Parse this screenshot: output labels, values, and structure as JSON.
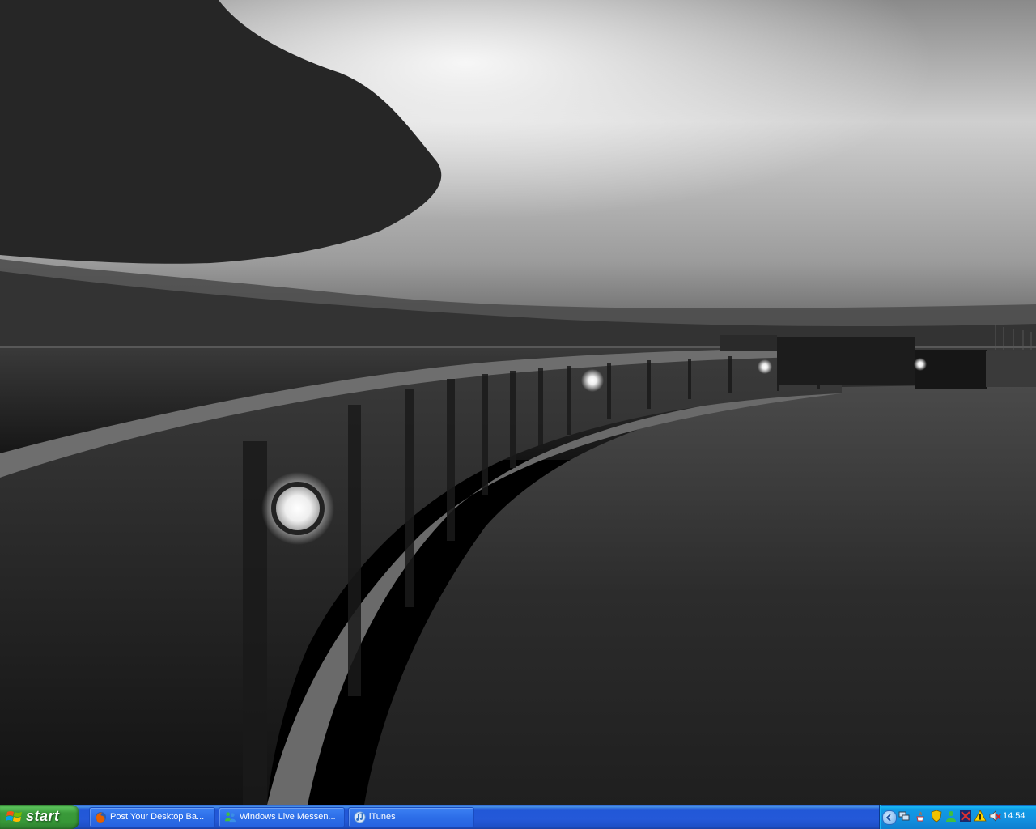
{
  "desktop": {
    "wallpaper_icon": "photo-wallpaper"
  },
  "taskbar": {
    "start_label": "start",
    "tasks": [
      {
        "label": "Post Your Desktop Ba...",
        "icon": "firefox-icon"
      },
      {
        "label": "Windows Live Messen...",
        "icon": "messenger-icon"
      },
      {
        "label": "iTunes",
        "icon": "itunes-icon"
      }
    ],
    "tray": {
      "icons": [
        "show-hidden-icons-icon",
        "network-icon",
        "java-icon",
        "security-shield-icon",
        "messenger-tray-icon",
        "antivirus-icon",
        "security-warning-icon",
        "volume-muted-icon"
      ],
      "clock": "14:54"
    },
    "colors": {
      "bar": "#245ed8",
      "start": "#3a9a3a",
      "tray": "#0f9ae5"
    }
  }
}
